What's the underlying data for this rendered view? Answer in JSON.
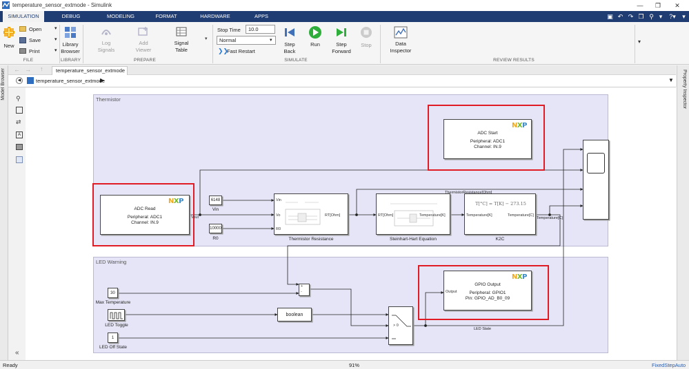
{
  "window": {
    "title": "temperature_sensor_extmode - Simulink"
  },
  "tabs": [
    {
      "label": "SIMULATION",
      "active": true
    },
    {
      "label": "DEBUG"
    },
    {
      "label": "MODELING"
    },
    {
      "label": "FORMAT"
    },
    {
      "label": "HARDWARE"
    },
    {
      "label": "APPS"
    }
  ],
  "ribbon": {
    "file": {
      "new": "New",
      "open": "Open",
      "save": "Save",
      "print": "Print",
      "group": "FILE"
    },
    "library": {
      "browser": "Library\nBrowser",
      "group": "LIBRARY"
    },
    "prepare": {
      "log_signals": "Log\nSignals",
      "add_viewer": "Add\nViewer",
      "signal_table": "Signal\nTable",
      "group": "PREPARE"
    },
    "simulate": {
      "stop_time_label": "Stop Time",
      "stop_time_value": "10.0",
      "mode": "Normal",
      "fast_restart": "Fast Restart",
      "step_back": "Step\nBack",
      "run": "Run",
      "step_forward": "Step\nForward",
      "stop": "Stop",
      "group": "SIMULATE"
    },
    "review": {
      "data_inspector": "Data\nInspector",
      "group": "REVIEW RESULTS"
    }
  },
  "nav": {
    "tab": "temperature_sensor_extmode",
    "breadcrumb": "temperature_sensor_extmode"
  },
  "side": {
    "left_label": "Model Browser",
    "right_label": "Property Inspector"
  },
  "status": {
    "left": "Ready",
    "zoom": "91%",
    "solver": "FixedStepAuto"
  },
  "diagram": {
    "thermistor_area": "Thermistor",
    "led_area": "LED Warning",
    "adc_start": {
      "title": "ADC Start",
      "line1": "Peripheral: ADC1",
      "line2": "Channel: IN.9",
      "logo": "NXP"
    },
    "adc_read": {
      "title": "ADC Read",
      "line1": "Peripheral: ADC1",
      "line2": "Channel: IN.9",
      "logo": "NXP",
      "port_out": "Vout"
    },
    "gpio_output": {
      "title": "GPIO Output",
      "line1": "Peripheral: GPIO1",
      "line2": "Pin: GPIO_AD_B0_09",
      "logo": "NXP",
      "port_in": "Output"
    },
    "vin_const": {
      "value": "6148",
      "label": "Vin"
    },
    "r0_const": {
      "value": "10000",
      "label": "R0"
    },
    "thermistor_resistance": {
      "label": "Thermistor Resistance",
      "port_vin": "Vin",
      "port_vo": "Vo",
      "port_r0": "R0",
      "port_out": "RT[Ohm]"
    },
    "steinhart": {
      "label": "Steinhart-Hart Equation",
      "port_in": "RT[Ohm]",
      "port_out": "Temperature[K]"
    },
    "k2c": {
      "label": "K2C",
      "port_in": "Temperature[K]",
      "port_out": "Temperature[C]",
      "formula": "T[°C] = T[K] − 273.15"
    },
    "signal_rt": "ThermistorResistance[Ohm]",
    "signal_temp": "Temperature[C]",
    "signal_led": "LED State",
    "max_temp": {
      "value": "30",
      "label": "Max Temperature"
    },
    "led_toggle": {
      "label": "LED Toggle"
    },
    "led_off": {
      "value": "1",
      "label": "LED Off State"
    },
    "sum_signs": {
      "plus": "+",
      "minus": "-"
    },
    "boolean_block": "boolean",
    "switch": {
      "threshold": "> 0"
    }
  }
}
